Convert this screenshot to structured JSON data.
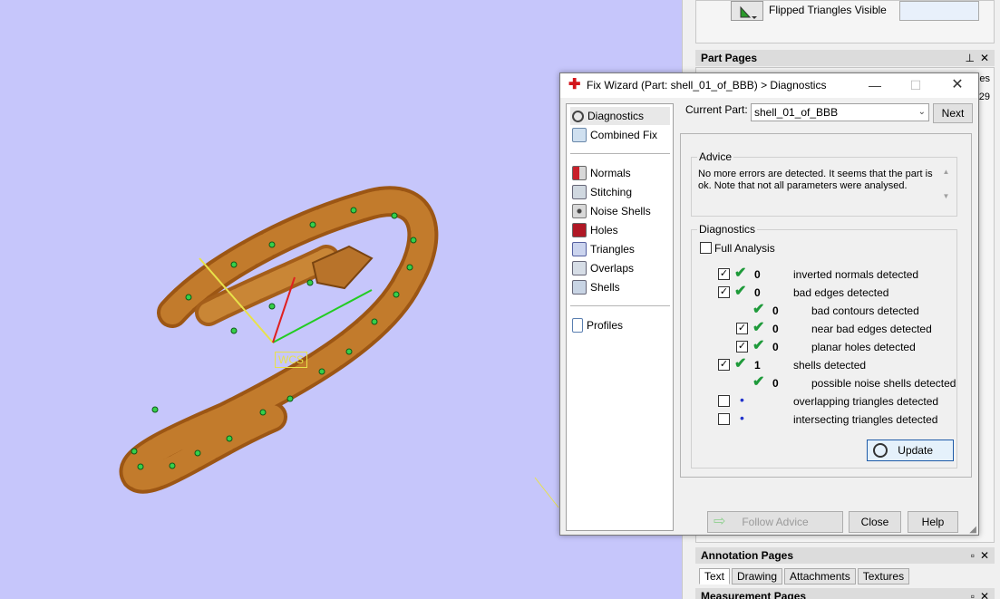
{
  "viewport": {
    "wcs_label": "WCS",
    "bg_color": "#c6c6fb",
    "model_color": "#b2641c"
  },
  "right_panel": {
    "flipped_label": "Flipped Triangles Visible",
    "part_pages_title": "Part Pages",
    "annotation_pages_title": "Annotation Pages",
    "measurement_pages_title": "Measurement Pages",
    "partial_count": "29",
    "partial_tab": "es",
    "annotation_tabs": [
      "Text",
      "Drawing",
      "Attachments",
      "Textures"
    ]
  },
  "dialog": {
    "title": "Fix Wizard (Part: shell_01_of_BBB) > Diagnostics",
    "nav_items": [
      {
        "label": "Diagnostics",
        "icon": "magnifier-icon"
      },
      {
        "label": "Combined Fix",
        "icon": "cube-icon"
      },
      {
        "label": "Normals",
        "icon": "normals-cube-icon"
      },
      {
        "label": "Stitching",
        "icon": "stitching-icon"
      },
      {
        "label": "Noise Shells",
        "icon": "noise-shells-icon"
      },
      {
        "label": "Holes",
        "icon": "holes-icon"
      },
      {
        "label": "Triangles",
        "icon": "triangles-icon"
      },
      {
        "label": "Overlaps",
        "icon": "overlaps-icon"
      },
      {
        "label": "Shells",
        "icon": "shells-icon"
      },
      {
        "label": "Profiles",
        "icon": "document-icon"
      }
    ],
    "current_part_label": "Current Part:",
    "current_part_value": "shell_01_of_BBB",
    "next_label": "Next",
    "advice_title": "Advice",
    "advice_text": "No more errors are detected. It seems that the part is ok. Note that not all parameters were analysed.",
    "diagnostics_title": "Diagnostics",
    "full_analysis_label": "Full Analysis",
    "diagnostics": [
      {
        "checkbox": true,
        "checked": true,
        "status": "ok",
        "count": "0",
        "label": "inverted normals detected",
        "indent": 0
      },
      {
        "checkbox": true,
        "checked": true,
        "status": "ok",
        "count": "0",
        "label": "bad edges detected",
        "indent": 0
      },
      {
        "checkbox": false,
        "checked": false,
        "status": "ok",
        "count": "0",
        "label": "bad contours detected",
        "indent": 1
      },
      {
        "checkbox": true,
        "checked": true,
        "status": "ok",
        "count": "0",
        "label": "near bad edges detected",
        "indent": 1
      },
      {
        "checkbox": true,
        "checked": true,
        "status": "ok",
        "count": "0",
        "label": "planar holes detected",
        "indent": 1
      },
      {
        "checkbox": true,
        "checked": true,
        "status": "ok",
        "count": "1",
        "label": "shells detected",
        "indent": 0
      },
      {
        "checkbox": false,
        "checked": false,
        "status": "ok",
        "count": "0",
        "label": "possible noise shells detected",
        "indent": 1
      },
      {
        "checkbox": true,
        "checked": false,
        "status": "none",
        "count": "",
        "label": "overlapping triangles detected",
        "indent": 0
      },
      {
        "checkbox": true,
        "checked": false,
        "status": "none",
        "count": "",
        "label": "intersecting triangles detected",
        "indent": 0
      }
    ],
    "update_label": "Update",
    "follow_advice_label": "Follow Advice",
    "close_label": "Close",
    "help_label": "Help"
  }
}
